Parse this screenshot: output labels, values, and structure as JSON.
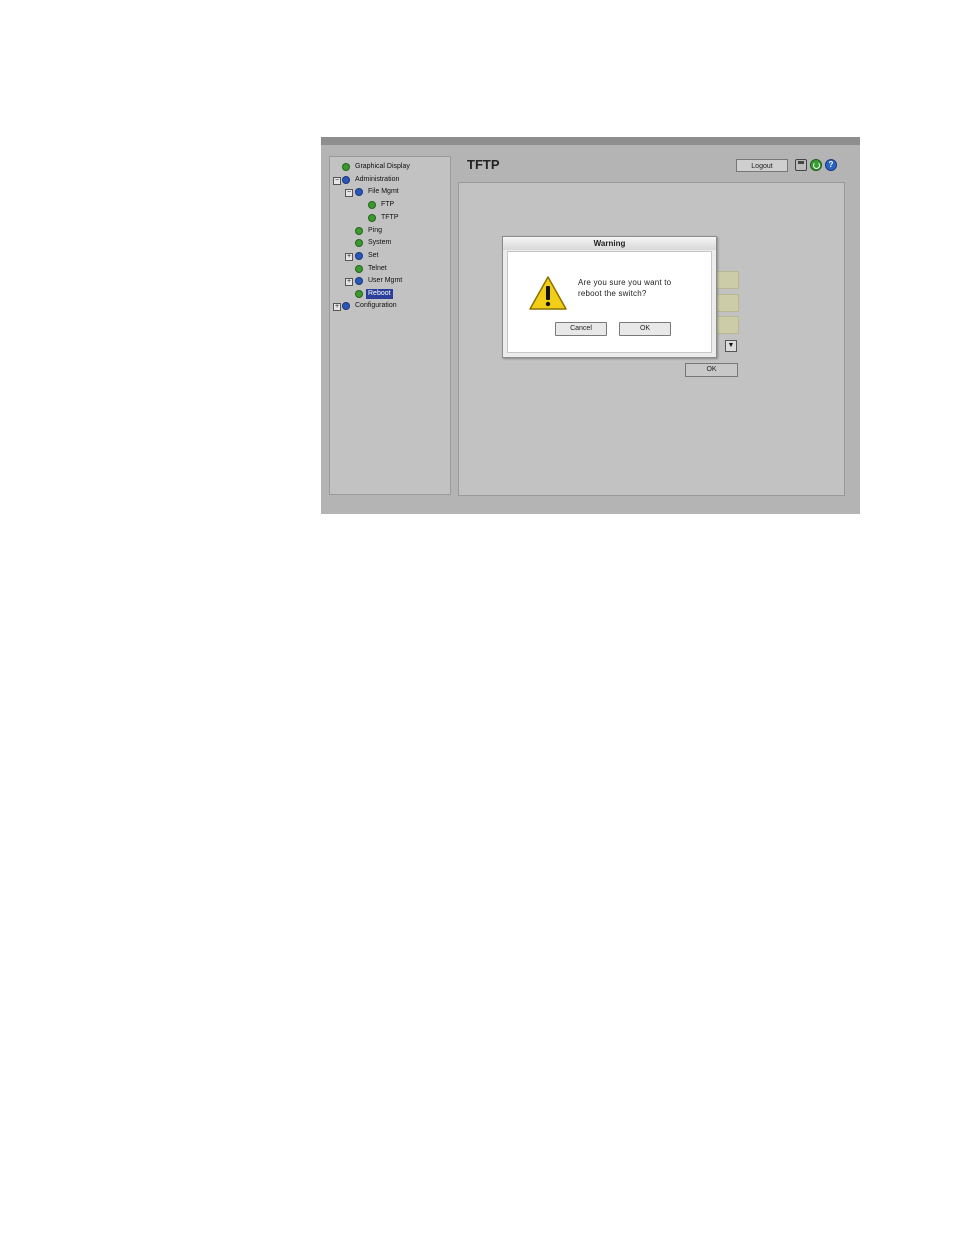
{
  "sidebar": {
    "items": [
      {
        "label": "Graphical Display",
        "icon": "green-bullet-icon"
      },
      {
        "label": "Administration",
        "icon": "blue-bullet-icon",
        "expander": "−"
      },
      {
        "label": "File Mgmt",
        "icon": "blue-bullet-icon",
        "expander": "−"
      },
      {
        "label": "FTP",
        "icon": "green-bullet-icon"
      },
      {
        "label": "TFTP",
        "icon": "green-bullet-icon"
      },
      {
        "label": "Ping",
        "icon": "green-bullet-icon"
      },
      {
        "label": "System",
        "icon": "green-bullet-icon"
      },
      {
        "label": "Set",
        "icon": "blue-bullet-icon",
        "expander": "+"
      },
      {
        "label": "Telnet",
        "icon": "green-bullet-icon"
      },
      {
        "label": "User Mgmt",
        "icon": "blue-bullet-icon",
        "expander": "+"
      },
      {
        "label": "Reboot",
        "icon": "green-bullet-icon",
        "selected": true
      },
      {
        "label": "Configuration",
        "icon": "blue-bullet-icon",
        "expander": "+"
      }
    ]
  },
  "header": {
    "title": "TFTP",
    "logout_label": "Logout",
    "help_glyph": "?"
  },
  "form": {
    "select_arrow": "▼",
    "ok_label": "OK"
  },
  "dialog": {
    "title": "Warning",
    "message_line1": "Are you sure you want to",
    "message_line2": "reboot the switch?",
    "cancel_label": "Cancel",
    "ok_label": "OK"
  },
  "colors": {
    "selection": "#2b3f9a",
    "bullet_green": "#3b9a2e",
    "bullet_blue": "#2a56b8",
    "warning_yellow": "#f2cf16"
  }
}
